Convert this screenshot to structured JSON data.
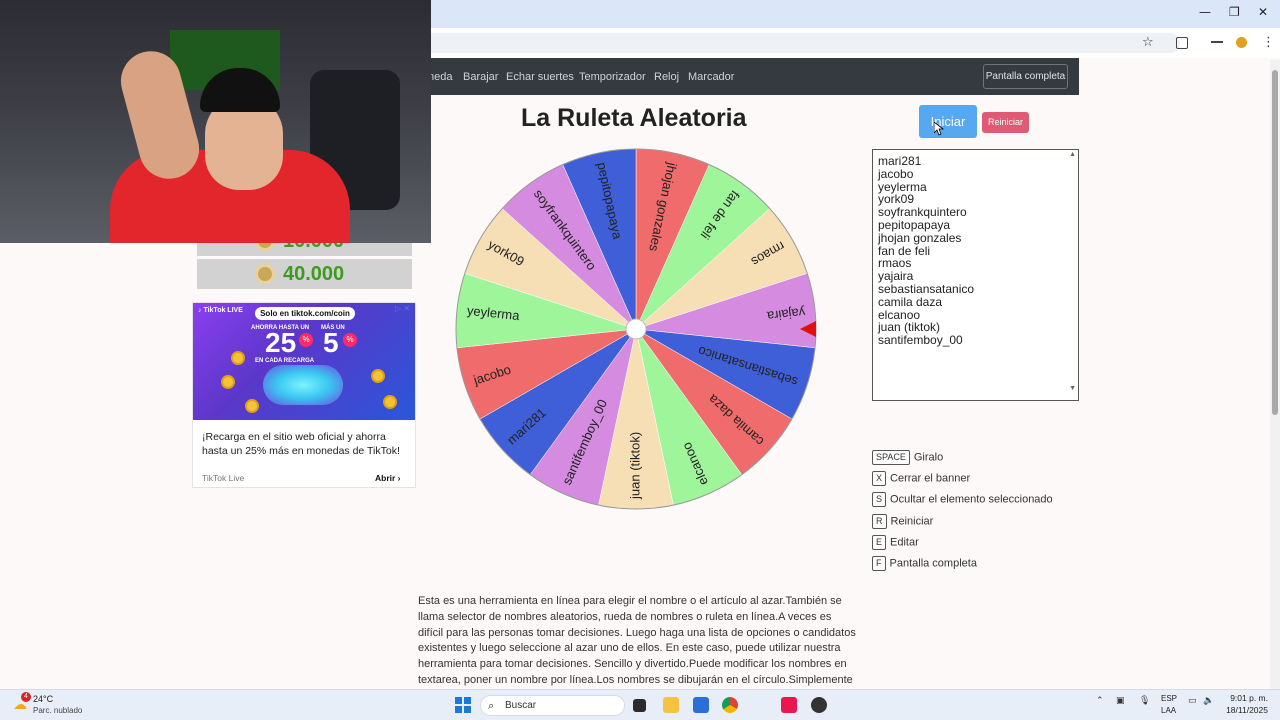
{
  "browser": {
    "minimize_glyph": "—",
    "restore_glyph": "❐",
    "close_glyph": "✕",
    "star_glyph": "☆",
    "menu_glyph": "⋮"
  },
  "nav": {
    "items": [
      "neda",
      "Barajar",
      "Echar suertes",
      "Temporizador",
      "Reloj",
      "Marcador"
    ],
    "fullscreen_label": "Pantalla completa"
  },
  "left_banner": {
    "coin_rows": [
      "10.000",
      "40.000"
    ],
    "ad": {
      "logo": "♪ TikTok LIVE",
      "top_pill": "Solo en tiktok.com/coin",
      "left_small": "AHORRA HASTA UN",
      "left_big": "25",
      "right_small": "MÁS UN",
      "right_big": "5",
      "pct": "%",
      "left_caption": "EN CADA RECARGA",
      "headline": "¡Recarga en el sitio web oficial y ahorra hasta un 25% más en monedas de TikTok!",
      "brand": "TikTok Live",
      "cta": "Abrir ›",
      "corner": "▷ ✕"
    }
  },
  "tool": {
    "title": "La Ruleta Aleatoria",
    "start_label": "Iniciar",
    "reset_label": "Reiniciar",
    "names": [
      "mari281",
      "jacobo",
      "yeylerma",
      "york09",
      "soyfrankquintero",
      "pepitopapaya",
      "jhojan gonzales",
      "fan de feli",
      "rmaos",
      "yajaira",
      "sebastiansatanico",
      "camila daza",
      "elcanoo",
      "juan (tiktok)",
      "santifemboy_00"
    ],
    "shortcuts": [
      {
        "key": "SPACE",
        "label": "Giralo"
      },
      {
        "key": "X",
        "label": "Cerrar el banner"
      },
      {
        "key": "S",
        "label": "Ocultar el elemento seleccionado"
      },
      {
        "key": "R",
        "label": "Reiniciar"
      },
      {
        "key": "E",
        "label": "Editar"
      },
      {
        "key": "F",
        "label": "Pantalla completa"
      }
    ],
    "description": "Esta es una herramienta en línea para elegir el nombre o el artículo al azar.También se llama selector de nombres aleatorios, rueda de nombres o ruleta en línea.A veces es difícil para las personas tomar decisiones. Luego haga una lista de opciones o candidatos existentes y luego seleccione al azar uno de ellos. En este caso, puede utilizar nuestra herramienta para tomar decisiones. Sencillo y divertido.Puede modificar los nombres en textarea, poner un nombre por línea.Los nombres se dibujarán en el círculo.Simplemente haga clic en la rueda"
  },
  "wheel_data": {
    "segments": [
      {
        "name": "jhojan gonzales",
        "color": "#f06b6b"
      },
      {
        "name": "fan de feli",
        "color": "#9ff59a"
      },
      {
        "name": "rmaos",
        "color": "#f6deb5"
      },
      {
        "name": "yajaira",
        "color": "#d58be0"
      },
      {
        "name": "sebastiansatanico",
        "color": "#3f5fd8"
      },
      {
        "name": "camila daza",
        "color": "#f06b6b"
      },
      {
        "name": "elcanoo",
        "color": "#9ff59a"
      },
      {
        "name": "juan (tiktok)",
        "color": "#f6deb5"
      },
      {
        "name": "santifemboy_00",
        "color": "#d58be0"
      },
      {
        "name": "mari281",
        "color": "#3f5fd8"
      },
      {
        "name": "jacobo",
        "color": "#f06b6b"
      },
      {
        "name": "yeylerma",
        "color": "#9ff59a"
      },
      {
        "name": "york09",
        "color": "#f6deb5"
      },
      {
        "name": "soyfrankquintero",
        "color": "#d58be0"
      },
      {
        "name": "pepitopapaya",
        "color": "#3f5fd8"
      }
    ],
    "pointer_color": "#e01010"
  },
  "taskbar": {
    "temp": "24°C",
    "weather": "Parc. nublado",
    "badge": "4",
    "search_placeholder": "Buscar",
    "lang_top": "ESP",
    "lang_bottom": "LAA",
    "time": "9:01 p. m.",
    "date": "18/11/2025"
  }
}
